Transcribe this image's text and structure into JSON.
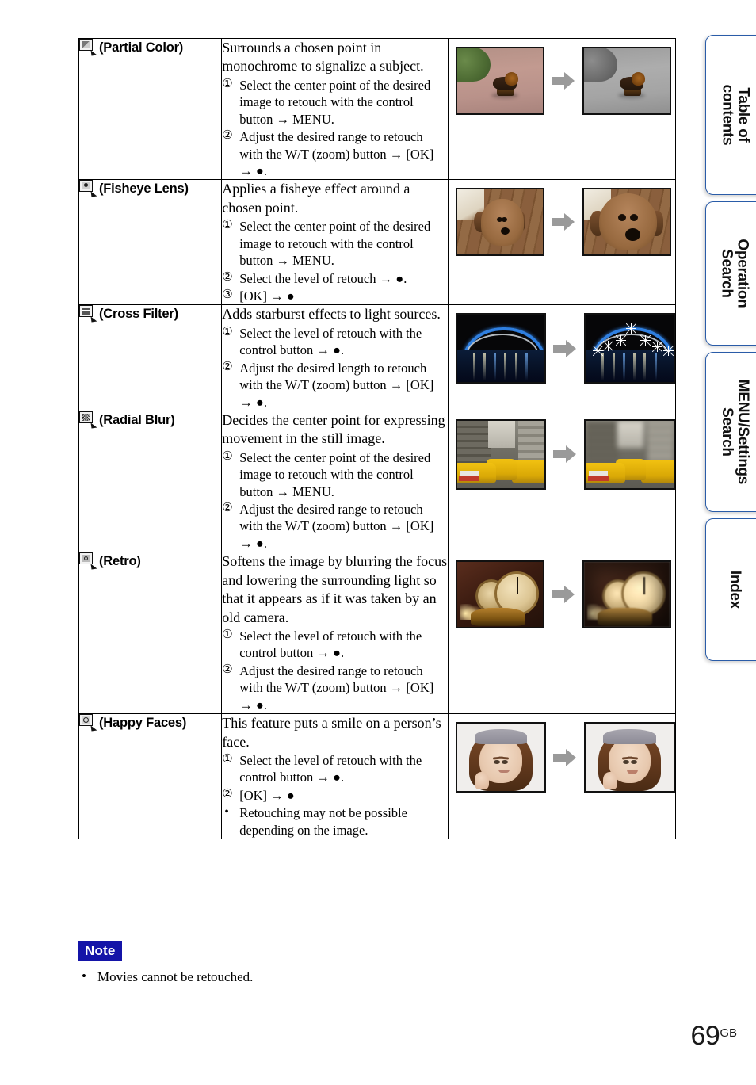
{
  "page": {
    "number": "69",
    "number_suffix": "GB"
  },
  "side_tabs": [
    {
      "id": "tab-table-of-contents",
      "line1": "Table of",
      "line2": "contents"
    },
    {
      "id": "tab-operation-search",
      "line1": "Operation",
      "line2": "Search"
    },
    {
      "id": "tab-menu-settings-search",
      "line1": "MENU/Settings",
      "line2": "Search"
    },
    {
      "id": "tab-index",
      "line1": "Index",
      "line2": ""
    }
  ],
  "table": {
    "rows": [
      {
        "icon": "partial-color-retouch-icon",
        "icon_style": "mono",
        "name": "(Partial Color)",
        "lead": "Surrounds a chosen point in monochrome to signalize a subject.",
        "steps": [
          {
            "marker": "①",
            "text": "Select the center point of the desired image to retouch with the control button → MENU."
          },
          {
            "marker": "②",
            "text": "Adjust the desired range to retouch with the W/T (zoom) button → [OK] → ●."
          }
        ],
        "sample": {
          "kind": "dog-path",
          "before_alt": "puppy on colored path",
          "after_alt": "puppy with monochrome surroundings"
        }
      },
      {
        "icon": "fisheye-lens-retouch-icon",
        "icon_style": "person",
        "name": "(Fisheye Lens)",
        "lead": "Applies a fisheye effect around a chosen point.",
        "steps": [
          {
            "marker": "①",
            "text": "Select the center point of the desired image to retouch with the control button → MENU."
          },
          {
            "marker": "②",
            "text": "Select the level of retouch → ●."
          },
          {
            "marker": "③",
            "text": "[OK] → ●"
          }
        ],
        "sample": {
          "kind": "dog-face",
          "before_alt": "dog on wooden floor",
          "after_alt": "dog with fisheye distortion"
        }
      },
      {
        "icon": "cross-filter-retouch-icon",
        "icon_style": "cross",
        "name": "(Cross Filter)",
        "lead": "Adds starburst effects to light sources.",
        "steps": [
          {
            "marker": "①",
            "text": "Select the level of retouch with the control button → ●."
          },
          {
            "marker": "②",
            "text": "Adjust the desired length to retouch with the W/T (zoom) button → [OK] → ●."
          }
        ],
        "sample": {
          "kind": "bridge-night",
          "before_alt": "illuminated bridge at night",
          "after_alt": "bridge with starburst light effects"
        }
      },
      {
        "icon": "radial-blur-retouch-icon",
        "icon_style": "radial",
        "name": "(Radial Blur)",
        "lead": "Decides the center point for expressing movement in the still image.",
        "steps": [
          {
            "marker": "①",
            "text": "Select the center point of the desired image to retouch with the control button → MENU."
          },
          {
            "marker": "②",
            "text": "Adjust the desired range to retouch with the W/T (zoom) button → [OK] → ●."
          }
        ],
        "sample": {
          "kind": "taxis",
          "before_alt": "yellow taxis on city street",
          "after_alt": "taxis with radial blur background"
        }
      },
      {
        "icon": "retro-retouch-icon",
        "icon_style": "retro",
        "name": "(Retro)",
        "lead": "Softens the image by blurring the focus and lowering the surrounding light so that it appears as if it was taken by an old camera.",
        "steps": [
          {
            "marker": "①",
            "text": "Select the level of retouch with the control button → ●."
          },
          {
            "marker": "②",
            "text": "Adjust the desired range to retouch with the W/T (zoom) button → [OK] → ●."
          }
        ],
        "sample": {
          "kind": "clock",
          "before_alt": "antique clock",
          "after_alt": "antique clock with retro effect"
        }
      },
      {
        "icon": "happy-faces-retouch-icon",
        "icon_style": "smile",
        "name": "(Happy Faces)",
        "lead": "This feature puts a smile on a person’s face.",
        "steps": [
          {
            "marker": "①",
            "text": "Select the level of retouch with the control button → ●."
          },
          {
            "marker": "②",
            "text": "[OK] → ●"
          },
          {
            "marker": "•",
            "bullet": true,
            "text": "Retouching may not be possible depending on the image."
          }
        ],
        "sample": {
          "kind": "face",
          "before_alt": "woman with neutral expression",
          "after_alt": "woman with smile"
        }
      }
    ]
  },
  "note": {
    "badge": "Note",
    "items": [
      {
        "marker": "•",
        "text": "Movies cannot be retouched."
      }
    ]
  },
  "colors": {
    "note_badge_bg": "#1414a8",
    "tab_border": "#2a5ca8",
    "table_border": "#000000",
    "arrow_gray": "#9a9a9a"
  }
}
